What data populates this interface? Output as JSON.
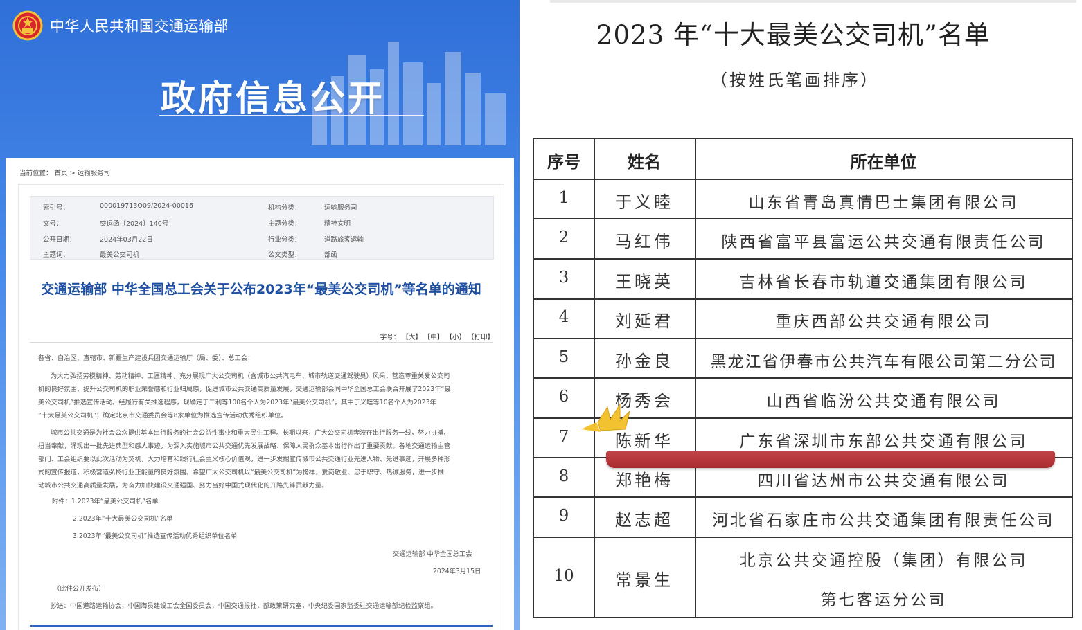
{
  "header": {
    "ministry_name": "中华人民共和国交通运输部",
    "banner_title": "政府信息公开"
  },
  "breadcrumb": {
    "label": "当前位置：",
    "home": "首页",
    "separator": ">",
    "section": "运输服务司"
  },
  "meta": {
    "index_label": "索引号：",
    "index_value": "000019713O09/2024-00016",
    "org_label": "机构分类：",
    "org_value": "运输服务司",
    "doc_label": "文号：",
    "doc_value": "交运函〔2024〕140号",
    "topic_label": "主题分类：",
    "topic_value": "精神文明",
    "date_label": "公开日期：",
    "date_value": "2024年03月22日",
    "industry_label": "行业分类：",
    "industry_value": "道路旅客运输",
    "keyword_label": "主题词：",
    "keyword_value": "最美公交司机",
    "type_label": "公文类型：",
    "type_value": "部函"
  },
  "article": {
    "title": "交通运输部 中华全国总工会关于公布2023年“最美公交司机”等名单的通知",
    "font_label": "字号：",
    "font_large": "【大】",
    "font_medium": "【中】",
    "font_small": "【小】",
    "print": "【打印】",
    "salutation": "各省、自治区、直辖市、新疆生产建设兵团交通运输厅（局、委）、总工会：",
    "para1_l1": "为大力弘扬劳模精神、劳动精神、工匠精神，充分展现广大公交司机（含城市公共汽电车、城市轨道交通驾驶员）风采，营造尊重关爱公交司",
    "para1_l2": "机的良好氛围，提升公交司机的职业荣誉感和行业归属感，促进城市公共交通高质量发展，交通运输部会同中华全国总工会联合开展了2023年“最",
    "para1_l3": "美公交司机”推选宣传活动。经履行有关推选程序，现确定于二利等100名个人为2023年“最美公交司机”，其中于义睦等10名个人为2023年",
    "para1_l4": "“十大最美公交司机”；确定北京市交通委员会等8家单位为推选宣传活动优秀组织单位。",
    "para2_l1": "城市公共交通是为社会公众提供基本出行服务的社会公益性事业和重大民生工程。长期以来，广大公交司机奔波在出行服务一线，努力拼搏、",
    "para2_l2": "扭当奉献，涌现出一批先进典型和感人事迹，为深入实施城市公共交通优先发展战略、保障人民群众基本出行作出了重要贡献。各地交通运输主管",
    "para2_l3": "部门、工会组织要以此次活动为契机，大力培育和践行社会主义核心价值观，进一步发掘宣传城市公共交通行业先进人物、先进事迹，开展多种形",
    "para2_l4": "式的宣传报道，积极营造弘扬行业正能量的良好氛围。希望广大公交司机以“最美公交司机”为榜样，爱岗敬业、忠于职守、热诚服务，进一步推",
    "para2_l5": "动城市公共交通高质量发展，为奋力加快建设交通强国、努力当好中国式现代化的开路先锋贡献力量。",
    "attach1": "附件：1.2023年“最美公交司机”名单",
    "attach2": "2.2023年“十大最美公交司机”名单",
    "attach3": "3.2023年“最美公交司机”推选宣传活动优秀组织单位名单",
    "signers": "交通运输部    中华全国总工会",
    "sign_date": "2024年3月15日",
    "publish_note": "（此件公开发布）",
    "cc": "抄送：中国道路运输协会，中国海员建设工会全国委员会，中国交通报社，部政策研究室，中央纪委国家监委驻交通运输部纪检监察组。"
  },
  "list": {
    "title": "2023 年“十大最美公交司机”名单",
    "subtitle": "（按姓氏笔画排序）",
    "headers": [
      "序号",
      "姓名",
      "所在单位"
    ],
    "rows": [
      {
        "no": "1",
        "name": "于义睦",
        "unit": "山东省青岛真情巴士集团有限公司"
      },
      {
        "no": "2",
        "name": "马红伟",
        "unit": "陕西省富平县富运公共交通有限责任公司"
      },
      {
        "no": "3",
        "name": "王晓英",
        "unit": "吉林省长春市轨道交通集团有限公司"
      },
      {
        "no": "4",
        "name": "刘延君",
        "unit": "重庆西部公共交通有限公司"
      },
      {
        "no": "5",
        "name": "孙金良",
        "unit": "黑龙江省伊春市公共汽车有限公司第二分公司"
      },
      {
        "no": "6",
        "name": "杨秀会",
        "unit": "山西省临汾公共交通有限公司"
      },
      {
        "no": "7",
        "name": "陈新华",
        "unit": "广东省深圳市东部公共交通有限公司"
      },
      {
        "no": "8",
        "name": "郑艳梅",
        "unit": "四川省达州市公共交通有限公司"
      },
      {
        "no": "9",
        "name": "赵志超",
        "unit": "河北省石家庄市公共交通集团有限责任公司"
      },
      {
        "no": "10",
        "name": "常景生",
        "unit": "北京公共交通控股（集团）有限公司",
        "unit2": "第七客运分公司"
      }
    ]
  },
  "colors": {
    "header_blue": "#2f6fd8",
    "title_blue": "#1f4fa0",
    "highlight_red": "#b53539",
    "crown_yellow": "#f2c230"
  }
}
